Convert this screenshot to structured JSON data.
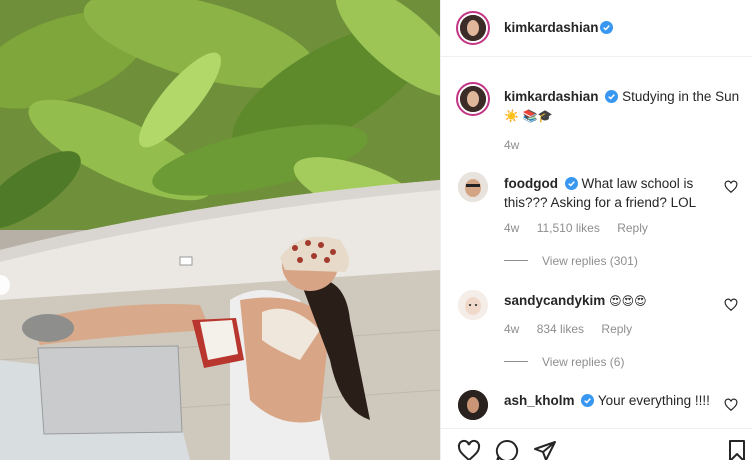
{
  "post": {
    "author": "kimkardashian",
    "caption_author": "kimkardashian",
    "caption_text": "Studying in the Sun",
    "caption_emoji": "☀️ 📚🎓",
    "caption_age": "4w"
  },
  "comments": [
    {
      "user": "foodgod",
      "verified": true,
      "text_line1": "What law school is",
      "text_line2": "this??? Asking for a friend? LOL",
      "age": "4w",
      "likes": "11,510 likes",
      "reply": "Reply",
      "view_replies": "View replies (301)"
    },
    {
      "user": "sandycandykim",
      "verified": false,
      "text_line1": "😍😍😍",
      "age": "4w",
      "likes": "834 likes",
      "reply": "Reply",
      "view_replies": "View replies (6)"
    },
    {
      "user": "ash_kholm",
      "verified": true,
      "text_line1": "Your everything !!!!"
    }
  ],
  "colors": {
    "verified_blue": "#3897f0",
    "muted_text": "#8e8e8e",
    "story_ring": "#c13584"
  },
  "icons": {
    "like": "heart-icon",
    "comment": "comment-icon",
    "share": "share-icon",
    "save": "bookmark-icon"
  }
}
